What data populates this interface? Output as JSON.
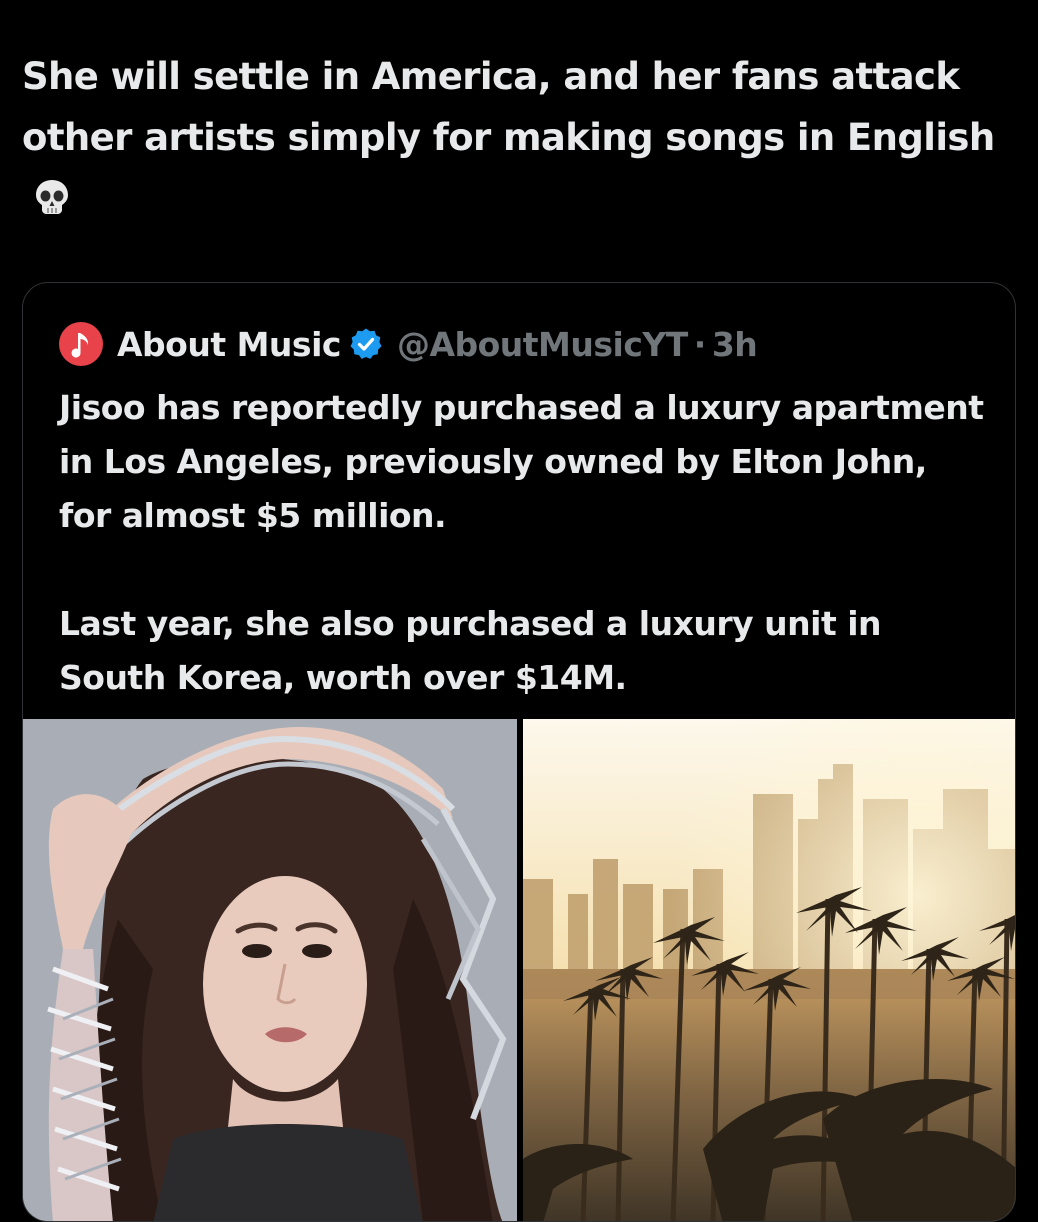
{
  "tweet": {
    "text": "She will settle in America, and her fans attack other artists simply for making songs in English"
  },
  "quote": {
    "author_name": "About Music",
    "handle": "@AboutMusicYT",
    "separator": "·",
    "time": "3h",
    "paragraph_1": "Jisoo has reportedly purchased a luxury apartment in Los Angeles, previously owned by Elton John, for almost $5 million.",
    "paragraph_2": "Last year, she also purchased a luxury unit in South Korea, worth over $14M.",
    "media": [
      {
        "kind": "photo",
        "subject": "portrait"
      },
      {
        "kind": "photo",
        "subject": "city skyline with palm trees"
      }
    ]
  },
  "icons": {
    "emoji": "skull-emoji-icon",
    "verified": "verified-badge-icon",
    "avatar": "music-note-icon"
  },
  "colors": {
    "background": "#000000",
    "text": "#e7e9ea",
    "secondary_text": "#71767b",
    "border": "#2f3336",
    "verified_blue": "#1d9bf0",
    "avatar_red": "#e8434b"
  }
}
